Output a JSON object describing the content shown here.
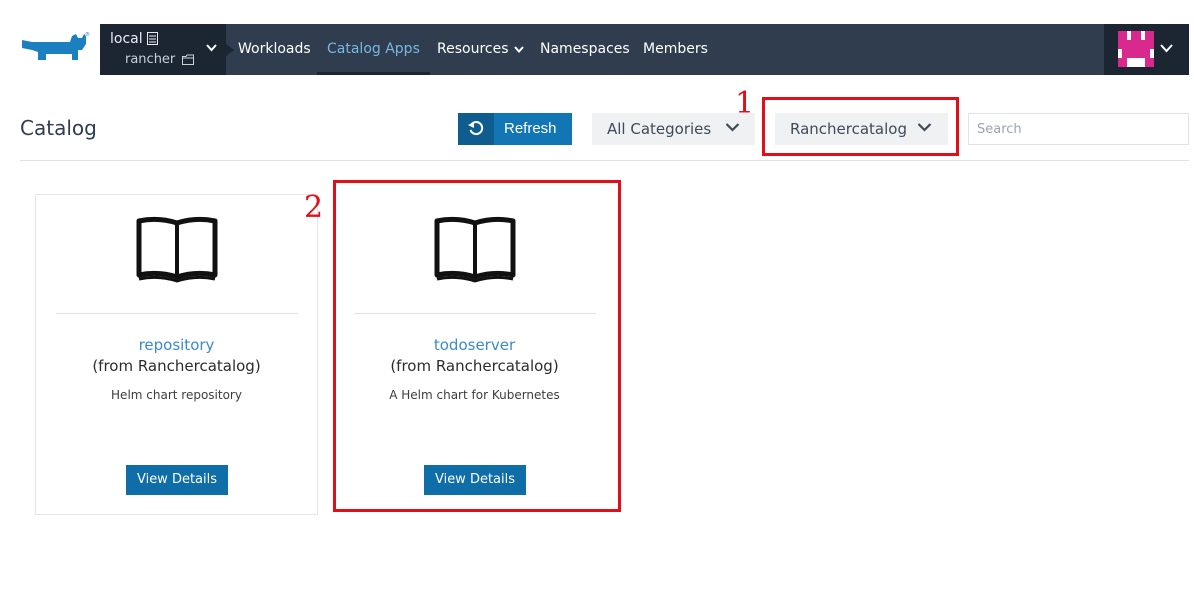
{
  "nav": {
    "cluster": {
      "name": "local",
      "project": "rancher"
    },
    "items": [
      {
        "label": "Workloads"
      },
      {
        "label": "Catalog Apps"
      },
      {
        "label": "Resources"
      },
      {
        "label": "Namespaces"
      },
      {
        "label": "Members"
      }
    ],
    "active_item": "Catalog Apps"
  },
  "header": {
    "title": "Catalog",
    "refresh_label": "Refresh",
    "category_select": "All Categories",
    "catalog_select": "Ranchercatalog",
    "search_placeholder": "Search"
  },
  "annotations": {
    "mark1": "1",
    "mark2": "2",
    "color": "#e0101a"
  },
  "cards": [
    {
      "name": "repository",
      "source": "(from Ranchercatalog)",
      "description": "Helm chart repository",
      "button": "View Details"
    },
    {
      "name": "todoserver",
      "source": "(from Ranchercatalog)",
      "description": "A Helm chart for Kubernetes",
      "button": "View Details"
    }
  ],
  "colors": {
    "nav_bg": "#2f3d4f",
    "nav_dark": "#1c2633",
    "accent": "#1376b4",
    "link": "#3b8ac9"
  }
}
